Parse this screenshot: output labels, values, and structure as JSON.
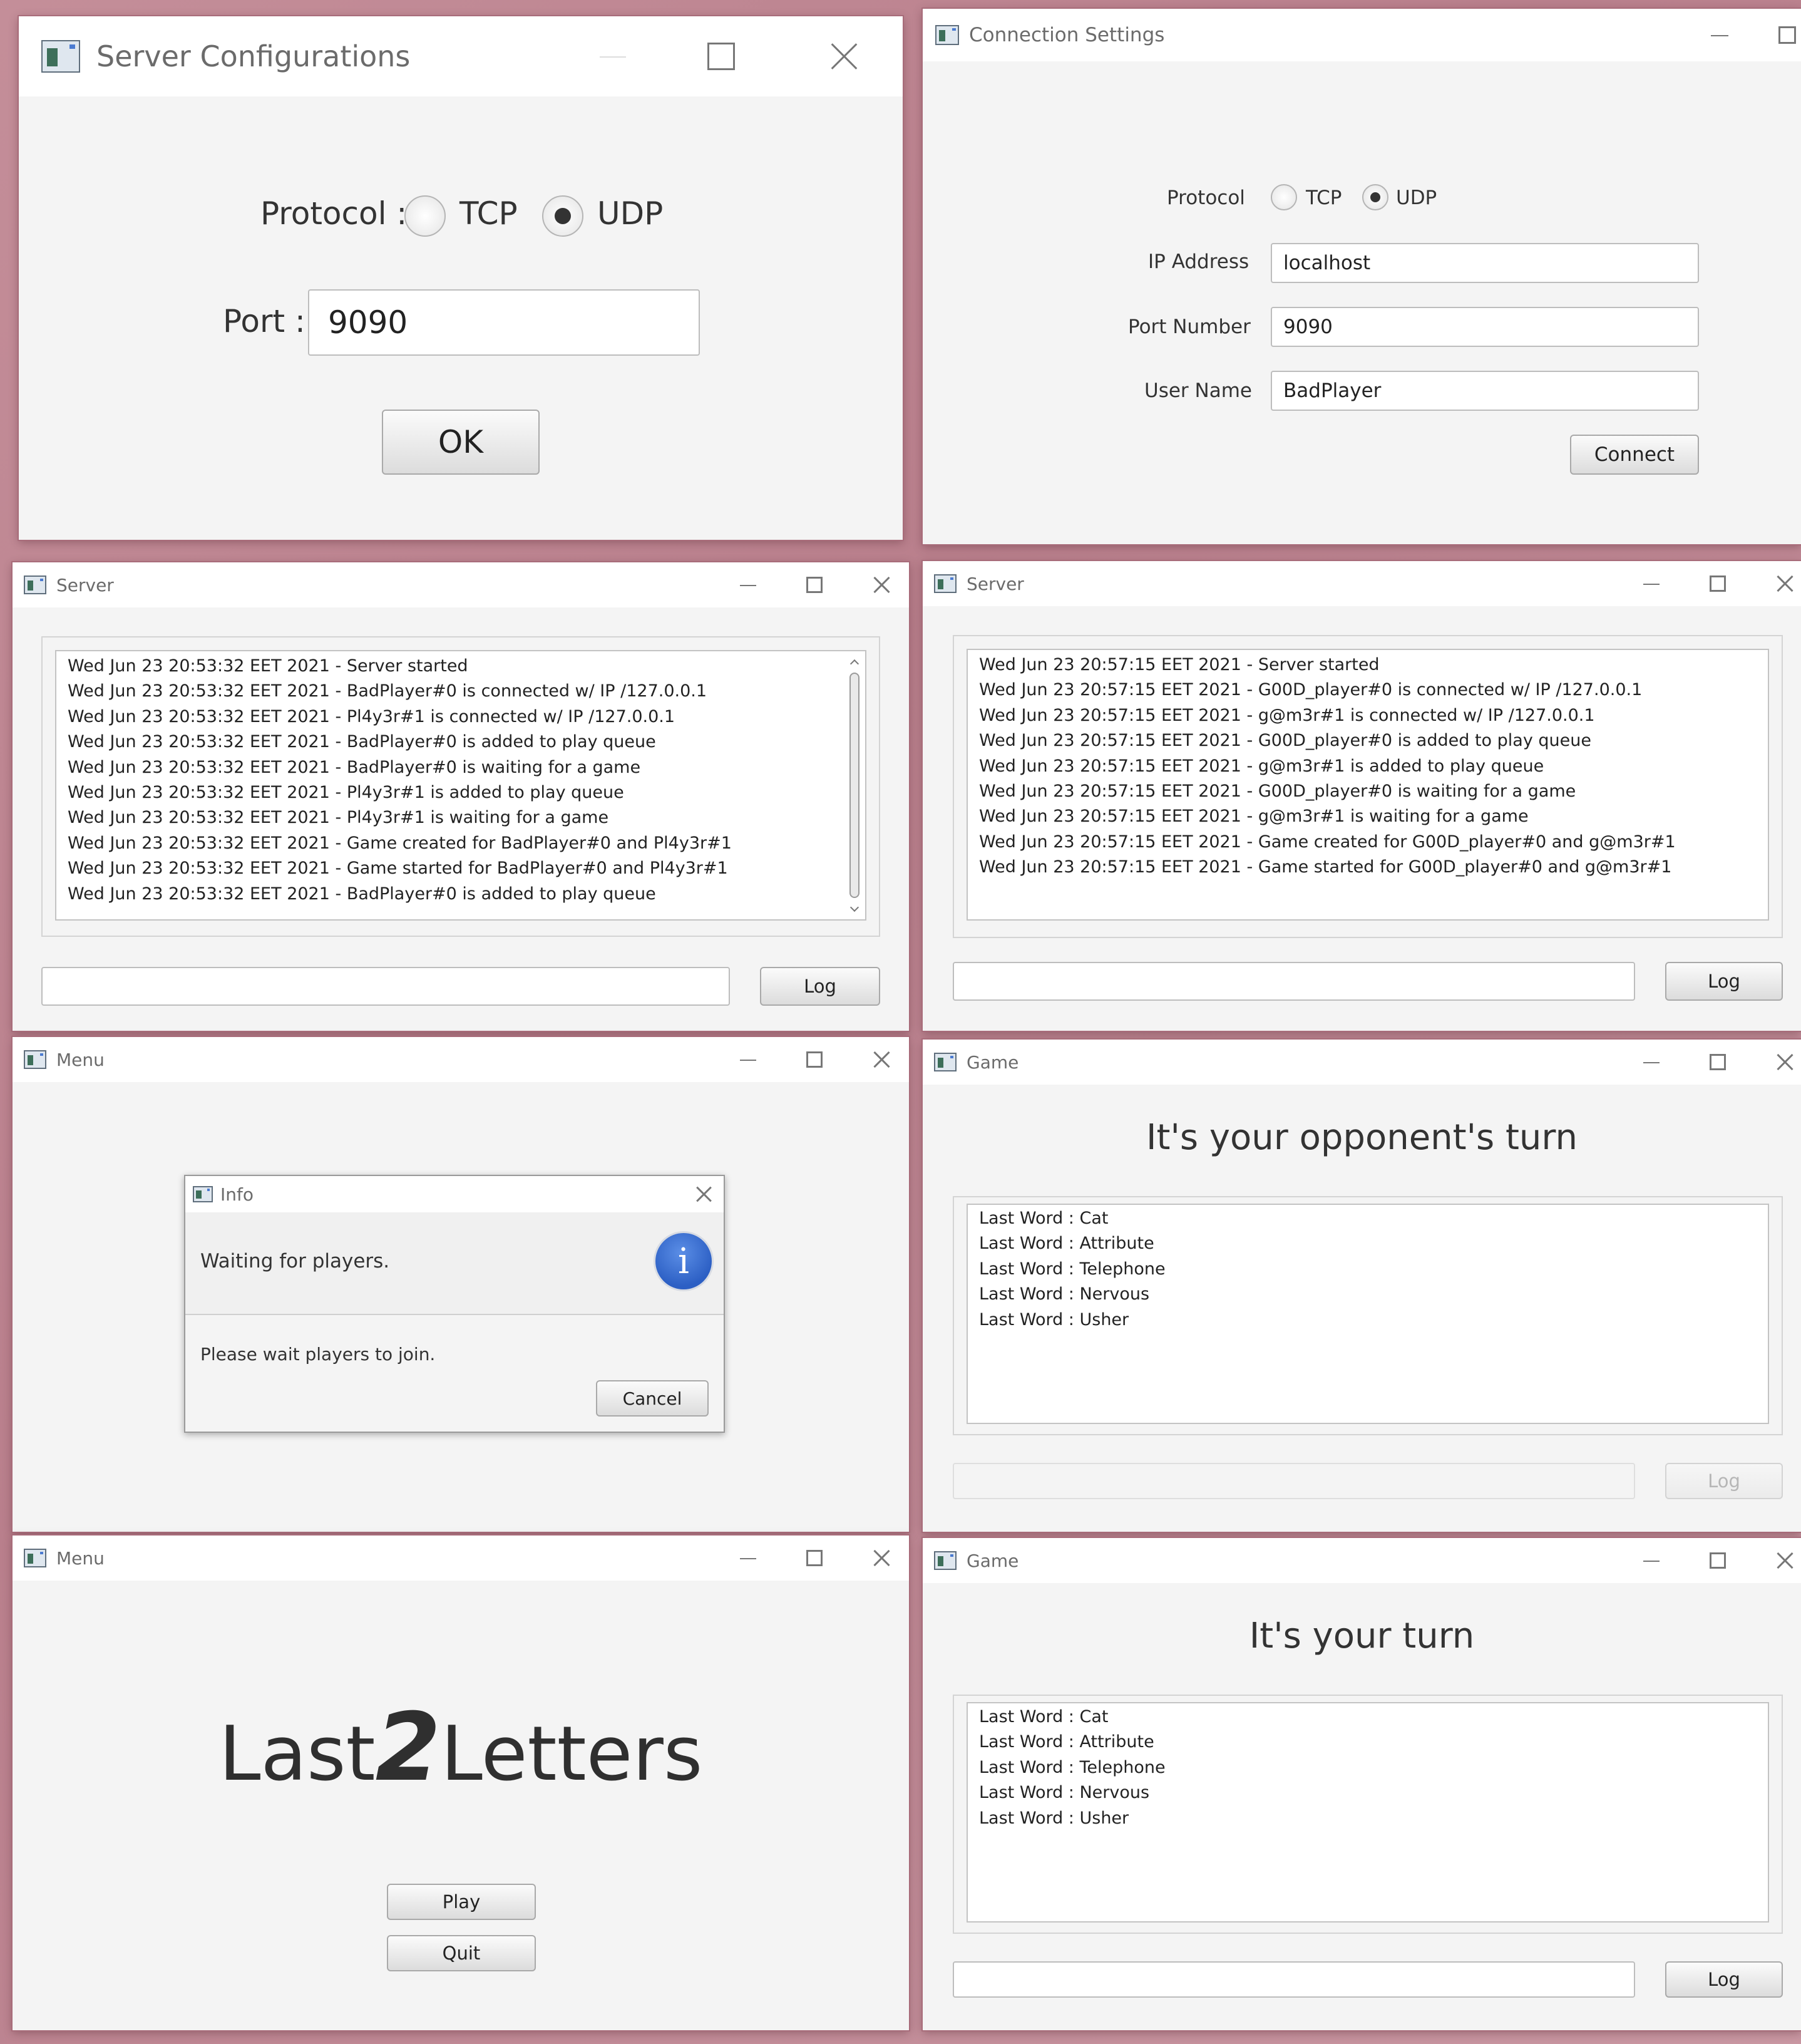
{
  "window_controls": {
    "minimize": "minimize-icon",
    "maximize": "maximize-icon",
    "close": "close-icon"
  },
  "server_config": {
    "title": "Server Configurations",
    "protocol_label": "Protocol :",
    "tcp_label": "TCP",
    "udp_label": "UDP",
    "selected_protocol": "UDP",
    "port_label": "Port :",
    "port_value": "9090",
    "ok_label": "OK"
  },
  "connection_settings": {
    "title": "Connection Settings",
    "protocol_label": "Protocol",
    "tcp_label": "TCP",
    "udp_label": "UDP",
    "selected_protocol": "UDP",
    "ip_label": "IP Address",
    "ip_value": "localhost",
    "port_label": "Port Number",
    "port_value": "9090",
    "user_label": "User Name",
    "user_value": "BadPlayer",
    "connect_label": "Connect"
  },
  "server_left": {
    "title": "Server",
    "log": [
      "Wed Jun 23 20:53:32 EET 2021 - Server started",
      "Wed Jun 23 20:53:32 EET 2021 - BadPlayer#0 is connected w/ IP /127.0.0.1",
      "Wed Jun 23 20:53:32 EET 2021 - Pl4y3r#1 is connected w/ IP /127.0.0.1",
      "Wed Jun 23 20:53:32 EET 2021 - BadPlayer#0 is added to play queue",
      "Wed Jun 23 20:53:32 EET 2021 - BadPlayer#0 is waiting for a game",
      "Wed Jun 23 20:53:32 EET 2021 - Pl4y3r#1 is added to play queue",
      "Wed Jun 23 20:53:32 EET 2021 - Pl4y3r#1 is waiting for a game",
      "Wed Jun 23 20:53:32 EET 2021 - Game created for BadPlayer#0 and Pl4y3r#1",
      "Wed Jun 23 20:53:32 EET 2021 - Game started for BadPlayer#0 and Pl4y3r#1",
      "Wed Jun 23 20:53:32 EET 2021 - BadPlayer#0 is added to play queue"
    ],
    "input_value": "",
    "log_button": "Log"
  },
  "server_right": {
    "title": "Server",
    "log": [
      "Wed Jun 23 20:57:15 EET 2021 - Server started",
      "Wed Jun 23 20:57:15 EET 2021 - G00D_player#0 is connected w/ IP /127.0.0.1",
      "Wed Jun 23 20:57:15 EET 2021 - g@m3r#1 is connected w/ IP /127.0.0.1",
      "Wed Jun 23 20:57:15 EET 2021 - G00D_player#0 is added to play queue",
      "Wed Jun 23 20:57:15 EET 2021 - g@m3r#1 is added to play queue",
      "Wed Jun 23 20:57:15 EET 2021 - G00D_player#0 is waiting for a game",
      "Wed Jun 23 20:57:15 EET 2021 - g@m3r#1 is waiting for a game",
      "Wed Jun 23 20:57:15 EET 2021 - Game created for G00D_player#0 and g@m3r#1",
      "Wed Jun 23 20:57:15 EET 2021 - Game started for G00D_player#0 and g@m3r#1"
    ],
    "input_value": "",
    "log_button": "Log"
  },
  "menu_waiting": {
    "title": "Menu",
    "dialog": {
      "title": "Info",
      "header": "Waiting for players.",
      "icon": "info-icon",
      "icon_glyph": "i",
      "message": "Please wait players to join.",
      "cancel_label": "Cancel"
    }
  },
  "game_opponent": {
    "title": "Game",
    "heading": "It's your opponent's turn",
    "words": [
      "Last Word : Cat",
      "Last Word : Attribute",
      "Last Word : Telephone",
      "Last Word : Nervous",
      "Last Word : Usher"
    ],
    "input_value": "",
    "log_button": "Log",
    "controls_enabled": false
  },
  "menu_main": {
    "title": "Menu",
    "logo_part1": "Last",
    "logo_part2": "2",
    "logo_part3": "Letters",
    "play_label": "Play",
    "quit_label": "Quit"
  },
  "game_yours": {
    "title": "Game",
    "heading": "It's your turn",
    "words": [
      "Last Word : Cat",
      "Last Word : Attribute",
      "Last Word : Telephone",
      "Last Word : Nervous",
      "Last Word : Usher"
    ],
    "input_value": "",
    "log_button": "Log",
    "controls_enabled": true
  }
}
